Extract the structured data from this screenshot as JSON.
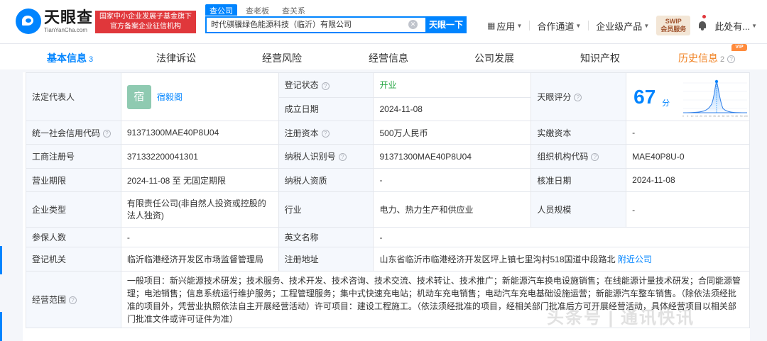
{
  "header": {
    "logo_cn": "天眼查",
    "logo_en": "TianYanCha.com",
    "gov_badge_line1": "国家中小企业发展子基金旗下",
    "gov_badge_line2": "官方备案企业征信机构",
    "search_tabs": [
      "查公司",
      "查老板",
      "查关系"
    ],
    "search_value": "时代骐骥绿色能源科技（临沂）有限公司",
    "search_button": "天眼一下",
    "nav": {
      "app": "应用",
      "partner": "合作通道",
      "enterprise": "企业级产品",
      "swip_line1": "SWIP",
      "swip_line2": "会员服务",
      "vip": "VIP",
      "user": "此处有..."
    }
  },
  "tabs": [
    {
      "label": "基本信息",
      "count": "3"
    },
    {
      "label": "法律诉讼"
    },
    {
      "label": "经营风险"
    },
    {
      "label": "经营信息"
    },
    {
      "label": "公司发展"
    },
    {
      "label": "知识产权"
    },
    {
      "label": "历史信息",
      "count": "2"
    }
  ],
  "info": {
    "legal_rep_label": "法定代表人",
    "legal_rep_avatar": "宿",
    "legal_rep_name": "宿毅阁",
    "reg_status_label": "登记状态",
    "reg_status_value": "开业",
    "found_date_label": "成立日期",
    "found_date_value": "2024-11-08",
    "score_label": "天眼评分",
    "score_value": "67",
    "score_unit": "分",
    "score_axis": [
      "0",
      "5",
      "10",
      "15",
      "20",
      "25",
      "30",
      "35",
      "40",
      "50",
      "60",
      "70",
      "80",
      "90",
      "100"
    ],
    "uscc_label": "统一社会信用代码",
    "uscc_value": "91371300MAE40P8U04",
    "reg_capital_label": "注册资本",
    "reg_capital_value": "500万人民币",
    "paid_capital_label": "实缴资本",
    "paid_capital_value": "-",
    "biz_reg_no_label": "工商注册号",
    "biz_reg_no_value": "371332200041301",
    "taxpayer_id_label": "纳税人识别号",
    "taxpayer_id_value": "91371300MAE40P8U04",
    "org_code_label": "组织机构代码",
    "org_code_value": "MAE40P8U-0",
    "biz_term_label": "营业期限",
    "biz_term_value": "2024-11-08 至 无固定期限",
    "taxpayer_qual_label": "纳税人资质",
    "taxpayer_qual_value": "-",
    "approve_date_label": "核准日期",
    "approve_date_value": "2024-11-08",
    "company_type_label": "企业类型",
    "company_type_value": "有限责任公司(非自然人投资或控股的法人独资)",
    "industry_label": "行业",
    "industry_value": "电力、热力生产和供应业",
    "staff_size_label": "人员规模",
    "staff_size_value": "-",
    "insured_label": "参保人数",
    "insured_value": "-",
    "en_name_label": "英文名称",
    "en_name_value": "-",
    "reg_authority_label": "登记机关",
    "reg_authority_value": "临沂临港经济开发区市场监督管理局",
    "reg_address_label": "注册地址",
    "reg_address_value": "山东省临沂市临港经济开发区坪上镇七里沟村518国道中段路北",
    "nearby_link": "附近公司",
    "scope_label": "经营范围",
    "scope_value": "一般项目：新兴能源技术研发；技术服务、技术开发、技术咨询、技术交流、技术转让、技术推广；新能源汽车换电设施销售；在线能源计量技术研发；合同能源管理；电池销售；信息系统运行维护服务；工程管理服务；集中式快速充电站；机动车充电销售；电动汽车充电基础设施运营；新能源汽车整车销售。（除依法须经批准的项目外，凭营业执照依法自主开展经营活动）许可项目：建设工程施工。（依法须经批准的项目，经相关部门批准后方可开展经营活动，具体经营项目以相关部门批准文件或许可证件为准）"
  },
  "watermark": "头条号 | 通讯快讯"
}
